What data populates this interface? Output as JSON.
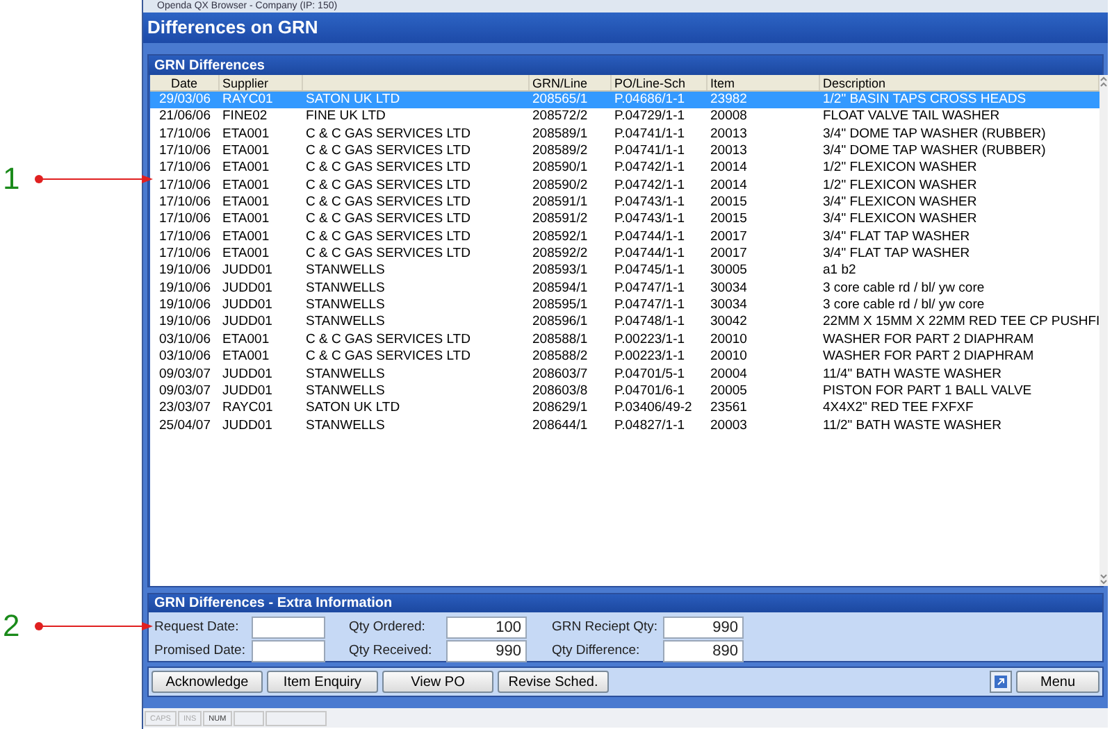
{
  "window": {
    "title": "Openda QX Browser  -  Company (IP: 150)"
  },
  "header": {
    "title": "Differences on GRN"
  },
  "annotations": [
    {
      "label": "1"
    },
    {
      "label": "2"
    }
  ],
  "grid": {
    "title": "GRN Differences",
    "columns": [
      "Date",
      "Supplier",
      "",
      "GRN/Line",
      "PO/Line-Sch",
      "Item",
      "Description"
    ],
    "rows": [
      {
        "selected": true,
        "cells": [
          "29/03/06",
          "RAYC01",
          "SATON UK LTD",
          "208565/1",
          "P.04686/1-1",
          "23982",
          "1/2\" BASIN TAPS CROSS HEADS"
        ]
      },
      {
        "selected": false,
        "cells": [
          "21/06/06",
          "FINE02",
          "FINE UK LTD",
          "208572/2",
          "P.04729/1-1",
          "20008",
          "FLOAT VALVE TAIL WASHER"
        ]
      },
      {
        "selected": false,
        "cells": [
          "17/10/06",
          "ETA001",
          "C & C GAS SERVICES LTD",
          "208589/1",
          "P.04741/1-1",
          "20013",
          "3/4\" DOME TAP WASHER (RUBBER)"
        ]
      },
      {
        "selected": false,
        "cells": [
          "17/10/06",
          "ETA001",
          "C & C GAS SERVICES LTD",
          "208589/2",
          "P.04741/1-1",
          "20013",
          "3/4\" DOME TAP WASHER (RUBBER)"
        ]
      },
      {
        "selected": false,
        "cells": [
          "17/10/06",
          "ETA001",
          "C & C GAS SERVICES LTD",
          "208590/1",
          "P.04742/1-1",
          "20014",
          "1/2\" FLEXICON WASHER"
        ]
      },
      {
        "selected": false,
        "cells": [
          "17/10/06",
          "ETA001",
          "C & C GAS SERVICES LTD",
          "208590/2",
          "P.04742/1-1",
          "20014",
          "1/2\" FLEXICON WASHER"
        ]
      },
      {
        "selected": false,
        "cells": [
          "17/10/06",
          "ETA001",
          "C & C GAS SERVICES LTD",
          "208591/1",
          "P.04743/1-1",
          "20015",
          "3/4\" FLEXICON WASHER"
        ]
      },
      {
        "selected": false,
        "cells": [
          "17/10/06",
          "ETA001",
          "C & C GAS SERVICES LTD",
          "208591/2",
          "P.04743/1-1",
          "20015",
          "3/4\" FLEXICON WASHER"
        ]
      },
      {
        "selected": false,
        "cells": [
          "17/10/06",
          "ETA001",
          "C & C GAS SERVICES LTD",
          "208592/1",
          "P.04744/1-1",
          "20017",
          "3/4\" FLAT TAP WASHER"
        ]
      },
      {
        "selected": false,
        "cells": [
          "17/10/06",
          "ETA001",
          "C & C GAS SERVICES LTD",
          "208592/2",
          "P.04744/1-1",
          "20017",
          "3/4\" FLAT TAP WASHER"
        ]
      },
      {
        "selected": false,
        "cells": [
          "19/10/06",
          "JUDD01",
          "STANWELLS",
          "208593/1",
          "P.04745/1-1",
          "30005",
          "a1 b2"
        ]
      },
      {
        "selected": false,
        "cells": [
          "19/10/06",
          "JUDD01",
          "STANWELLS",
          "208594/1",
          "P.04747/1-1",
          "30034",
          "3 core cable rd / bl/ yw core"
        ]
      },
      {
        "selected": false,
        "cells": [
          "19/10/06",
          "JUDD01",
          "STANWELLS",
          "208595/1",
          "P.04747/1-1",
          "30034",
          "3 core cable rd / bl/ yw core"
        ]
      },
      {
        "selected": false,
        "cells": [
          "19/10/06",
          "JUDD01",
          "STANWELLS",
          "208596/1",
          "P.04748/1-1",
          "30042",
          "22MM X 15MM X 22MM RED TEE CP PUSHFI"
        ]
      },
      {
        "selected": false,
        "cells": [
          "03/10/06",
          "ETA001",
          "C & C GAS SERVICES LTD",
          "208588/1",
          "P.00223/1-1",
          "20010",
          "WASHER FOR PART 2 DIAPHRAM"
        ]
      },
      {
        "selected": false,
        "cells": [
          "03/10/06",
          "ETA001",
          "C & C GAS SERVICES LTD",
          "208588/2",
          "P.00223/1-1",
          "20010",
          "WASHER FOR PART 2 DIAPHRAM"
        ]
      },
      {
        "selected": false,
        "cells": [
          "09/03/07",
          "JUDD01",
          "STANWELLS",
          "208603/7",
          "P.04701/5-1",
          "20004",
          "11/4\" BATH WASTE WASHER"
        ]
      },
      {
        "selected": false,
        "cells": [
          "09/03/07",
          "JUDD01",
          "STANWELLS",
          "208603/8",
          "P.04701/6-1",
          "20005",
          "PISTON FOR PART 1 BALL VALVE"
        ]
      },
      {
        "selected": false,
        "cells": [
          "23/03/07",
          "RAYC01",
          "SATON UK LTD",
          "208629/1",
          "P.03406/49-2",
          "23561",
          "4X4X2\" RED TEE FXFXF"
        ]
      },
      {
        "selected": false,
        "cells": [
          "25/04/07",
          "JUDD01",
          "STANWELLS",
          "208644/1",
          "P.04827/1-1",
          "20003",
          "11/2\" BATH WASTE WASHER"
        ]
      }
    ]
  },
  "extra_info": {
    "title": "GRN Differences - Extra Information",
    "fields": [
      {
        "label": "Request Date:"
      },
      {
        "label": "Qty Ordered:",
        "value": "100"
      },
      {
        "label": "GRN Reciept Qty:",
        "value": "990"
      },
      {
        "label": "Promised Date:"
      },
      {
        "label": "Qty Received:",
        "value": "990"
      },
      {
        "label": "Qty Difference:",
        "value": "890"
      }
    ]
  },
  "buttons": [
    "Acknowledge",
    "Item Enquiry",
    "View PO",
    "Revise Sched."
  ],
  "menu_button": "Menu",
  "status_bar": [
    {
      "label": "CAPS",
      "on": false
    },
    {
      "label": "INS",
      "on": false
    },
    {
      "label": "NUM",
      "on": true
    }
  ]
}
